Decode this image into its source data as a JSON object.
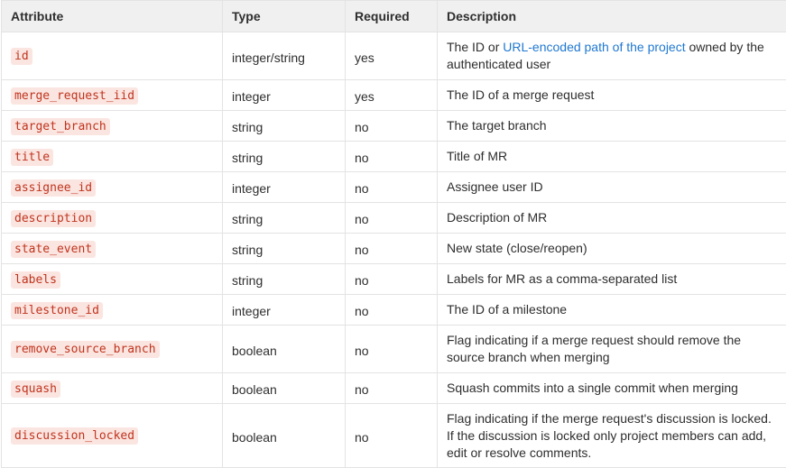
{
  "table": {
    "headers": [
      "Attribute",
      "Type",
      "Required",
      "Description"
    ],
    "rows": [
      {
        "attribute": "id",
        "type": "integer/string",
        "required": "yes",
        "description_pre": "The ID or ",
        "description_link": "URL-encoded path of the project",
        "description_post": " owned by the authenticated user"
      },
      {
        "attribute": "merge_request_iid",
        "type": "integer",
        "required": "yes",
        "description": "The ID of a merge request"
      },
      {
        "attribute": "target_branch",
        "type": "string",
        "required": "no",
        "description": "The target branch"
      },
      {
        "attribute": "title",
        "type": "string",
        "required": "no",
        "description": "Title of MR"
      },
      {
        "attribute": "assignee_id",
        "type": "integer",
        "required": "no",
        "description": "Assignee user ID"
      },
      {
        "attribute": "description",
        "type": "string",
        "required": "no",
        "description": "Description of MR"
      },
      {
        "attribute": "state_event",
        "type": "string",
        "required": "no",
        "description": "New state (close/reopen)"
      },
      {
        "attribute": "labels",
        "type": "string",
        "required": "no",
        "description": "Labels for MR as a comma-separated list"
      },
      {
        "attribute": "milestone_id",
        "type": "integer",
        "required": "no",
        "description": "The ID of a milestone"
      },
      {
        "attribute": "remove_source_branch",
        "type": "boolean",
        "required": "no",
        "description": "Flag indicating if a merge request should remove the source branch when merging"
      },
      {
        "attribute": "squash",
        "type": "boolean",
        "required": "no",
        "description": "Squash commits into a single commit when merging"
      },
      {
        "attribute": "discussion_locked",
        "type": "boolean",
        "required": "no",
        "description": "Flag indicating if the merge request's discussion is locked. If the discussion is locked only project members can add, edit or resolve comments."
      }
    ]
  },
  "colors": {
    "code_text": "#c0341d",
    "code_bg": "#fbe5e1",
    "link": "#1f78d1",
    "header_bg": "#f0f0f0",
    "border": "#e3e3e3"
  }
}
